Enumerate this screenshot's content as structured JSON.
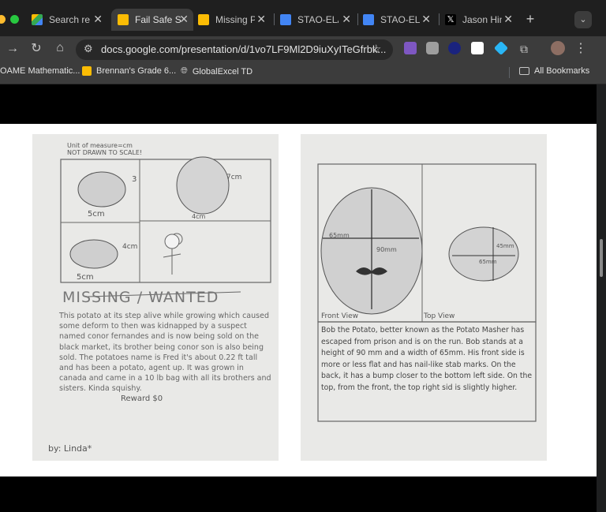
{
  "tabs": [
    {
      "title": "Search re",
      "favicon": "google-drive-icon",
      "active": false
    },
    {
      "title": "Fail Safe S",
      "favicon": "google-slides-icon",
      "active": true
    },
    {
      "title": "Missing P",
      "favicon": "google-slides-icon",
      "active": false
    },
    {
      "title": "STAO-ELA",
      "favicon": "google-docs-icon",
      "active": false
    },
    {
      "title": "STAO-ELA",
      "favicon": "google-docs-icon",
      "active": false
    },
    {
      "title": "Jason Hin",
      "favicon": "x-icon",
      "active": false
    }
  ],
  "address_bar": {
    "url": "docs.google.com/presentation/d/1vo7LF9Ml2D9iuXyITeGfrbk..."
  },
  "bookmarks": [
    {
      "label": "OAME Mathematic...",
      "icon": "folder-icon"
    },
    {
      "label": "Brennan's Grade 6...",
      "icon": "slides-icon"
    },
    {
      "label": "GlobalExcel TD",
      "icon": "globe-icon"
    }
  ],
  "all_bookmarks_label": "All Bookmarks",
  "colors": {
    "accent": "#fbbc04",
    "docs_blue": "#4285f4",
    "tab_active": "#3c3c3c"
  },
  "left_poster": {
    "unit_note": "Unit of measure=cm",
    "scale_note": "NOT DRAWN TO SCALE!",
    "dim_top_left_width": "5cm",
    "dim_top_left_height": "3",
    "dim_top_right_height": "7cm",
    "dim_top_right_width": "4cm",
    "dim_bottom_left_height": "4cm",
    "dim_bottom_left_width": "5cm",
    "heading": "MISSING / WANTED",
    "body": "This potato at its step alive while growing which caused some deform to then was kidnapped by a suspect named conor fernandes and is now being sold on the black market, its brother being conor son is also being sold. The potatoes name is Fred it's about 0.22 ft tall and has been a potato, agent up. It was grown in canada and came in a 10 lb bag with all its brothers and sisters. Kinda squishy.",
    "reward": "Reward $0",
    "signature": "by: Linda*"
  },
  "right_poster": {
    "dim_width": "65mm",
    "dim_height": "90mm",
    "dim_top_a": "45mm",
    "dim_top_b": "65mm",
    "label_front": "Front View",
    "label_top": "Top View",
    "body": "Bob the Potato, better known as the Potato Masher has escaped from prison and is on the run. Bob stands at a height of 90 mm and a width of 65mm. His front side is more or less flat and has nail-like stab marks. On the back, it has a bump closer to the bottom left side. On the top, from the front, the top right sid is slightly higher."
  }
}
